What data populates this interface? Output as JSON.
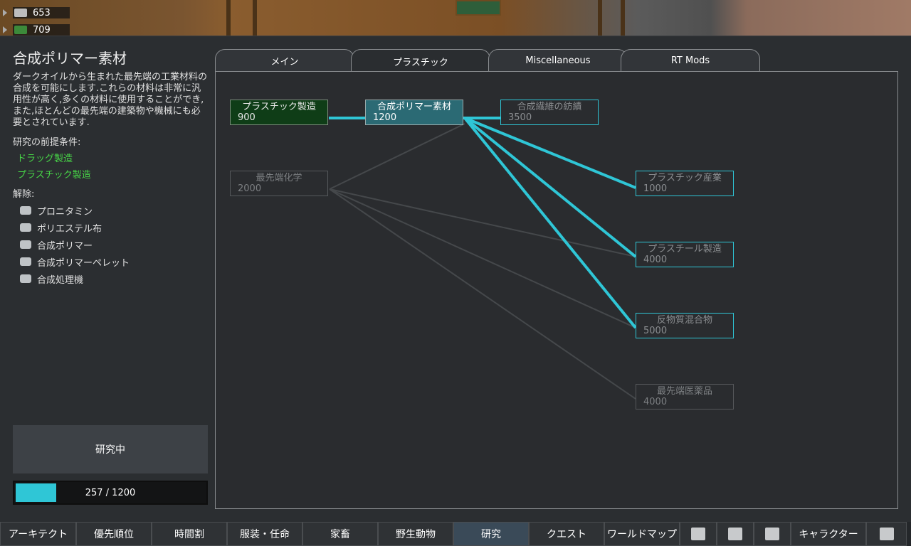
{
  "resources": [
    {
      "icon": "silver-icon",
      "value": "653"
    },
    {
      "icon": "food-icon",
      "value": "709"
    }
  ],
  "project": {
    "title": "合成ポリマー素材",
    "description": "ダークオイルから生まれた最先端の工業材料の合成を可能にします.これらの材料は非常に汎用性が高く,多くの材料に使用することができ,また,ほとんどの最先端の建築物や機械にも必要とされています.",
    "prereq_label": "研究の前提条件:",
    "prereqs": [
      "ドラッグ製造",
      "プラスチック製造"
    ],
    "unlocks_label": "解除:",
    "unlocks": [
      {
        "icon": "pills-icon",
        "label": "プロニタミン"
      },
      {
        "icon": "cloth-icon",
        "label": "ポリエステル布"
      },
      {
        "icon": "polymer-icon",
        "label": "合成ポリマー"
      },
      {
        "icon": "pellet-icon",
        "label": "合成ポリマーペレット"
      },
      {
        "icon": "machine-icon",
        "label": "合成処理機"
      }
    ],
    "status_button": "研究中",
    "progress": {
      "current": 257,
      "total": 1200,
      "text": "257 / 1200"
    }
  },
  "tabs": [
    {
      "label": "メイン",
      "active": false
    },
    {
      "label": "プラスチック",
      "active": true
    },
    {
      "label": "Miscellaneous",
      "active": false
    },
    {
      "label": "RT Mods",
      "active": false
    }
  ],
  "nodes": [
    {
      "id": "plastic-mfg",
      "name": "プラスチック製造",
      "cost": "900",
      "state": "done"
    },
    {
      "id": "synth-polymer",
      "name": "合成ポリマー素材",
      "cost": "1200",
      "state": "current"
    },
    {
      "id": "synth-fiber",
      "name": "合成繊維の紡績",
      "cost": "3500",
      "state": "avail"
    },
    {
      "id": "adv-chem",
      "name": "最先端化学",
      "cost": "2000",
      "state": "locked"
    },
    {
      "id": "plastic-industry",
      "name": "プラスチック産業",
      "cost": "1000",
      "state": "avail"
    },
    {
      "id": "plasteel",
      "name": "プラスチール製造",
      "cost": "4000",
      "state": "avail"
    },
    {
      "id": "antimatter",
      "name": "反物質混合物",
      "cost": "5000",
      "state": "avail"
    },
    {
      "id": "adv-medicine",
      "name": "最先端医薬品",
      "cost": "4000",
      "state": "locked"
    }
  ],
  "bottom_bar": [
    {
      "label": "アーキテクト"
    },
    {
      "label": "優先順位"
    },
    {
      "label": "時間割"
    },
    {
      "label": "服装・任命"
    },
    {
      "label": "家畜"
    },
    {
      "label": "野生動物"
    },
    {
      "label": "研究",
      "active": true
    },
    {
      "label": "クエスト"
    },
    {
      "label": "ワールドマップ"
    },
    {
      "icon": "book-icon"
    },
    {
      "icon": "factions-icon"
    },
    {
      "icon": "broom-icon"
    },
    {
      "label": "キャラクター"
    },
    {
      "icon": "menu-icon"
    }
  ]
}
